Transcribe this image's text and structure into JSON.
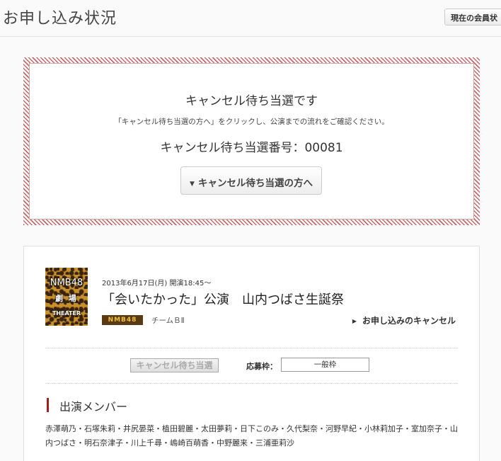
{
  "header": {
    "title": "お申し込み状況",
    "member_button": "現在の会員状"
  },
  "notice": {
    "title": "キャンセル待ち当選です",
    "message": "「キャンセル待ち当選の方へ」をクリックし、公演までの流れをご確認ください。",
    "number_text": "キャンセル待ち当選番号：00081",
    "button_label": "キャンセル待ち当選の方へ"
  },
  "performance": {
    "thumbnail": {
      "line1": "NMB48",
      "line2": "劇 場",
      "line3": "THEATER"
    },
    "date": "2013年6月17日(月) 開演18:45～",
    "title": "「会いたかった」公演　山内つばさ生誕祭",
    "team_logo": "NMB48",
    "team": "チームＢⅡ",
    "cancel_link": "お申し込みのキャンセル",
    "status": "キャンセル待ち当選",
    "apply_label": "応募枠：",
    "apply_value": "一般枠"
  },
  "cast": {
    "section_title": "出演メンバー",
    "members": "赤澤萌乃・石塚朱莉・井尻晏菜・植田碧麗・太田夢莉・日下このみ・久代梨奈・河野早紀・小林莉加子・室加奈子・山内つばさ・明石奈津子・川上千尋・嶋崎百萌香・中野麗来・三浦亜莉沙"
  },
  "icons": {
    "dropdown": "caret-down-icon",
    "link": "caret-right-icon"
  },
  "colors": {
    "accent": "#a02020",
    "notice_stripe": "#c66666"
  }
}
